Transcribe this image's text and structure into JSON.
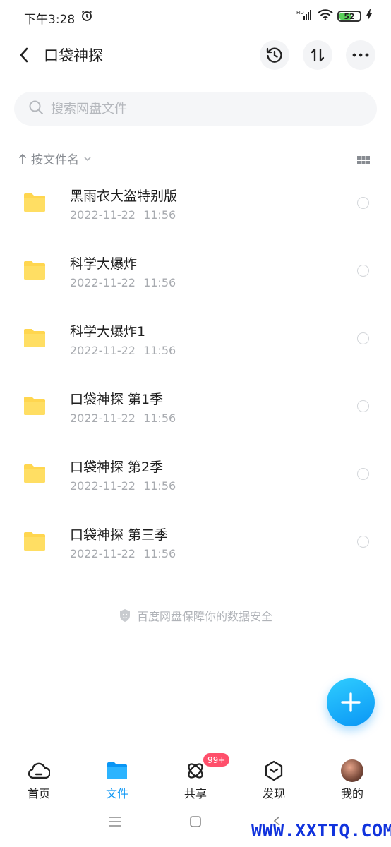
{
  "status_bar": {
    "time": "下午3:28",
    "network": "HD",
    "battery": "52"
  },
  "header": {
    "title": "口袋神探",
    "icons": [
      "back-arrow-icon",
      "history-icon",
      "sort-transfer-icon",
      "more-icon"
    ]
  },
  "search": {
    "placeholder": "搜索网盘文件",
    "value": ""
  },
  "sort": {
    "label": "按文件名"
  },
  "files": [
    {
      "name": "黑雨衣大盗特别版",
      "date": "2022-11-22 11:56"
    },
    {
      "name": "科学大爆炸",
      "date": "2022-11-22 11:56"
    },
    {
      "name": "科学大爆炸1",
      "date": "2022-11-22 11:56"
    },
    {
      "name": "口袋神探 第1季",
      "date": "2022-11-22 11:56"
    },
    {
      "name": "口袋神探 第2季",
      "date": "2022-11-22 11:56"
    },
    {
      "name": "口袋神探 第三季",
      "date": "2022-11-22 11:56"
    }
  ],
  "footer_note": "百度网盘保障你的数据安全",
  "tabs": [
    {
      "label": "首页",
      "icon": "home-cloud-icon"
    },
    {
      "label": "文件",
      "icon": "folder-icon",
      "active": true
    },
    {
      "label": "共享",
      "icon": "share-icon",
      "badge": "99+"
    },
    {
      "label": "发现",
      "icon": "discover-icon"
    },
    {
      "label": "我的",
      "icon": "avatar"
    }
  ],
  "watermark": "WWW.XXTTQ.COM",
  "colors": {
    "accent": "#0a96f5",
    "folder": "#ffd64f",
    "badge": "#ff4f6b"
  }
}
